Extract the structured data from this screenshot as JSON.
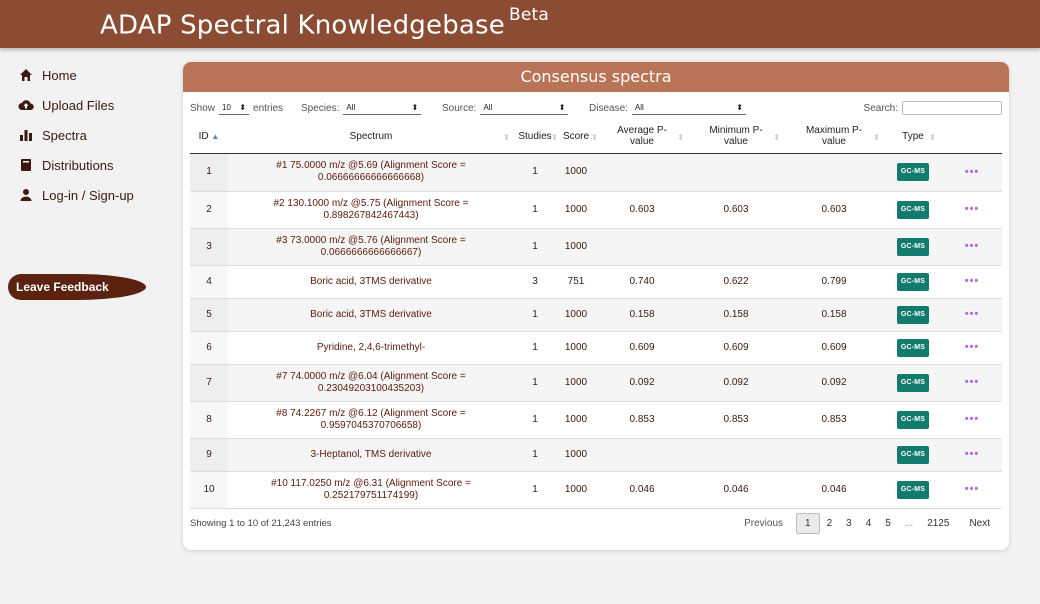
{
  "app": {
    "title": "ADAP Spectral Knowledgebase",
    "title_suffix": "Beta"
  },
  "sidebar": {
    "items": [
      {
        "label": "Home",
        "icon": "home-icon"
      },
      {
        "label": "Upload Files",
        "icon": "cloud-upload-icon"
      },
      {
        "label": "Spectra",
        "icon": "bar-chart-icon"
      },
      {
        "label": "Distributions",
        "icon": "book-icon"
      },
      {
        "label": "Log-in / Sign-up",
        "icon": "user-icon"
      }
    ],
    "feedback": "Leave Feedback"
  },
  "card": {
    "title": "Consensus spectra"
  },
  "controls": {
    "show_label": "Show",
    "entries_value": "10",
    "entries_label": "entries",
    "species_label": "Species:",
    "species_value": "All",
    "source_label": "Source:",
    "source_value": "All",
    "disease_label": "Disease:",
    "disease_value": "All",
    "search_label": "Search:"
  },
  "table": {
    "headers": [
      "ID",
      "Spectrum",
      "Studies",
      "Score",
      "Average P-value",
      "Minimum P-value",
      "Maximum P-value",
      "Type"
    ],
    "rows": [
      {
        "id": "1",
        "spectrum": [
          "#1 75.0000 m/z @5.69 (Alignment Score =",
          "0.06666666666666668)"
        ],
        "studies": "1",
        "score": "1000",
        "avg": "",
        "min": "",
        "max": "",
        "type": "GC-MS"
      },
      {
        "id": "2",
        "spectrum": [
          "#2 130.1000 m/z @5.75 (Alignment Score =",
          "0.898267842467443)"
        ],
        "studies": "1",
        "score": "1000",
        "avg": "0.603",
        "min": "0.603",
        "max": "0.603",
        "type": "GC-MS"
      },
      {
        "id": "3",
        "spectrum": [
          "#3 73.0000 m/z @5.76 (Alignment Score =",
          "0.0666666666666667)"
        ],
        "studies": "1",
        "score": "1000",
        "avg": "",
        "min": "",
        "max": "",
        "type": "GC-MS"
      },
      {
        "id": "4",
        "spectrum": [
          "Boric acid, 3TMS derivative"
        ],
        "studies": "3",
        "score": "751",
        "avg": "0.740",
        "min": "0.622",
        "max": "0.799",
        "type": "GC-MS"
      },
      {
        "id": "5",
        "spectrum": [
          "Boric acid, 3TMS derivative"
        ],
        "studies": "1",
        "score": "1000",
        "avg": "0.158",
        "min": "0.158",
        "max": "0.158",
        "type": "GC-MS"
      },
      {
        "id": "6",
        "spectrum": [
          "Pyridine, 2,4,6-trimethyl-"
        ],
        "studies": "1",
        "score": "1000",
        "avg": "0.609",
        "min": "0.609",
        "max": "0.609",
        "type": "GC-MS"
      },
      {
        "id": "7",
        "spectrum": [
          "#7 74.0000 m/z @6.04 (Alignment Score =",
          "0.23049203100435203)"
        ],
        "studies": "1",
        "score": "1000",
        "avg": "0.092",
        "min": "0.092",
        "max": "0.092",
        "type": "GC-MS"
      },
      {
        "id": "8",
        "spectrum": [
          "#8 74.2267 m/z @6.12 (Alignment Score =",
          "0.9597045370706658)"
        ],
        "studies": "1",
        "score": "1000",
        "avg": "0.853",
        "min": "0.853",
        "max": "0.853",
        "type": "GC-MS"
      },
      {
        "id": "9",
        "spectrum": [
          "3-Heptanol, TMS derivative"
        ],
        "studies": "1",
        "score": "1000",
        "avg": "",
        "min": "",
        "max": "",
        "type": "GC-MS"
      },
      {
        "id": "10",
        "spectrum": [
          "#10 117.0250 m/z @6.31 (Alignment Score =",
          "0.252179751174199)"
        ],
        "studies": "1",
        "score": "1000",
        "avg": "0.046",
        "min": "0.046",
        "max": "0.046",
        "type": "GC-MS"
      }
    ],
    "more_label": "•••"
  },
  "footer": {
    "info": "Showing 1 to 10 of 21,243 entries",
    "pages": [
      "Previous",
      "1",
      "2",
      "3",
      "4",
      "5",
      "...",
      "2125",
      "Next"
    ],
    "current_page": "1"
  },
  "colors": {
    "header": "#8b4c33",
    "card_header": "#b97458",
    "badge": "#137a6e",
    "more": "#b36bd6"
  }
}
